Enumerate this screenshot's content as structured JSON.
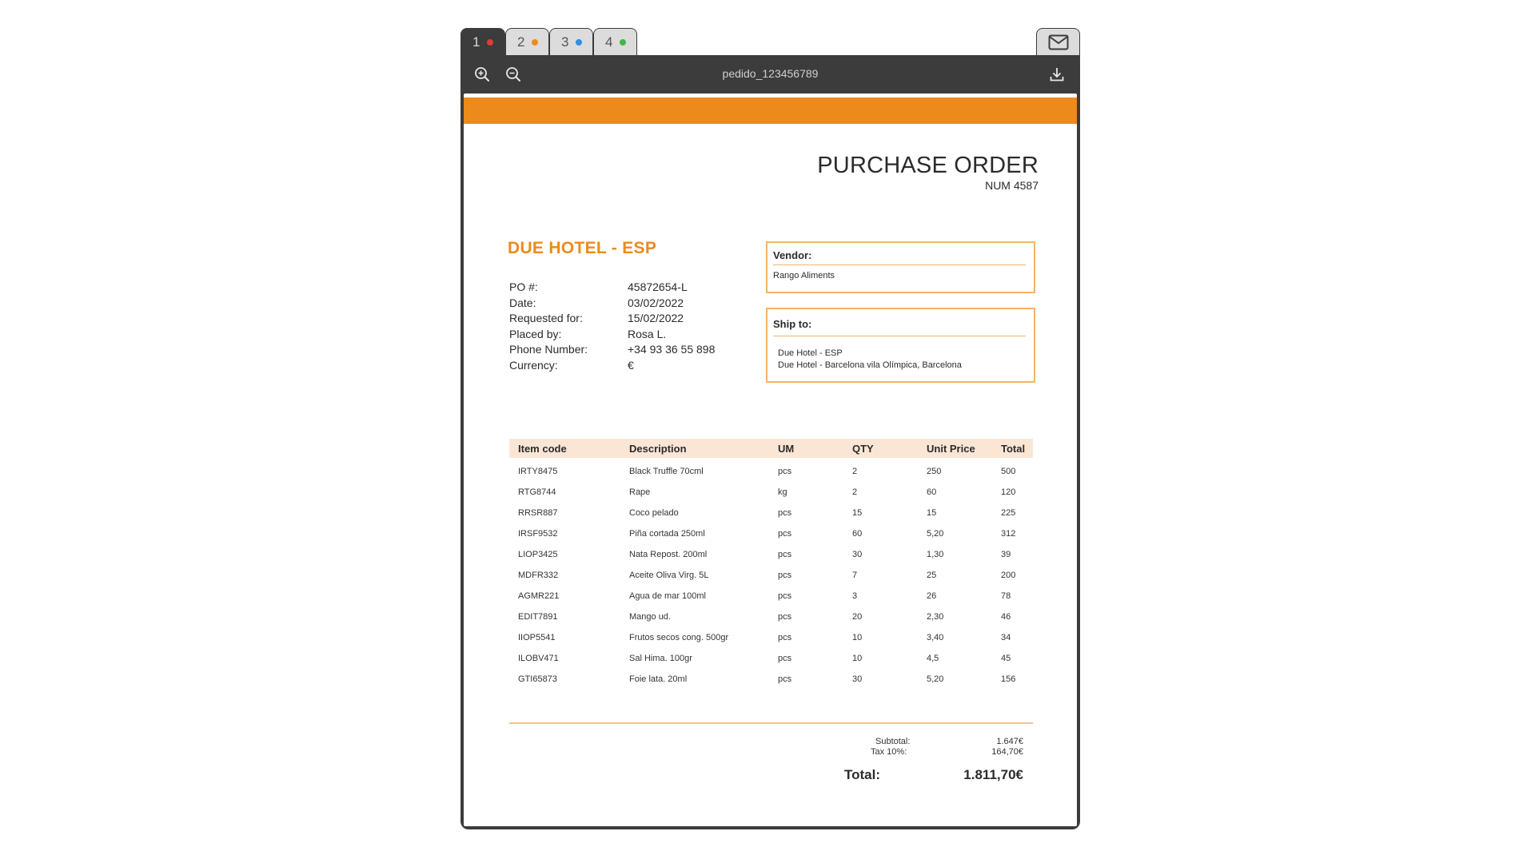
{
  "tabs": [
    {
      "label": "1",
      "dot_color": "#e53935"
    },
    {
      "label": "2",
      "dot_color": "#ef8b1c"
    },
    {
      "label": "3",
      "dot_color": "#2f8fe0"
    },
    {
      "label": "4",
      "dot_color": "#43b649"
    }
  ],
  "icons": {
    "mail": "mail-icon",
    "zoom_in": "zoom-in-icon",
    "zoom_out": "zoom-out-icon",
    "download": "download-icon"
  },
  "viewer": {
    "doc_title": "pedido_123456789"
  },
  "colors": {
    "accent": "#ed8a1c",
    "table_header_bg": "#fbe6d6",
    "box_border": "#f3b46a",
    "toolbar_bg": "#3c3c3c"
  },
  "document": {
    "title": "PURCHASE ORDER",
    "number": "NUM 4587",
    "company": "DUE HOTEL - ESP",
    "meta": [
      {
        "label": "PO #:",
        "value": "45872654-L"
      },
      {
        "label": "Date:",
        "value": "03/02/2022"
      },
      {
        "label": "Requested for:",
        "value": "15/02/2022"
      },
      {
        "label": "Placed by:",
        "value": "Rosa L."
      },
      {
        "label": "Phone Number:",
        "value": "+34 93 36 55 898"
      },
      {
        "label": "Currency:",
        "value": "€"
      }
    ],
    "vendor": {
      "title": "Vendor:",
      "lines": [
        "Rango Aliments"
      ]
    },
    "ship_to": {
      "title": "Ship to:",
      "lines": [
        "Due Hotel - ESP",
        "Due Hotel - Barcelona vila Olímpica, Barcelona"
      ]
    },
    "table": {
      "headers": [
        "Item code",
        "Description",
        "UM",
        "QTY",
        "Unit Price",
        "Total"
      ],
      "rows": [
        [
          "IRTY8475",
          "Black Truffle 70cml",
          "pcs",
          "2",
          "250",
          "500"
        ],
        [
          "RTG8744",
          "Rape",
          "kg",
          "2",
          "60",
          "120"
        ],
        [
          "RRSR887",
          "Coco pelado",
          "pcs",
          "15",
          "15",
          "225"
        ],
        [
          "IRSF9532",
          "Piña cortada 250ml",
          "pcs",
          "60",
          "5,20",
          "312"
        ],
        [
          "LIOP3425",
          "Nata Repost. 200ml",
          "pcs",
          "30",
          "1,30",
          "39"
        ],
        [
          "MDFR332",
          "Aceite Oliva Virg. 5L",
          "pcs",
          "7",
          "25",
          "200"
        ],
        [
          "AGMR221",
          "Agua de mar 100ml",
          "pcs",
          "3",
          "26",
          "78"
        ],
        [
          "EDIT7891",
          "Mango ud.",
          "pcs",
          "20",
          "2,30",
          "46"
        ],
        [
          "IIOP5541",
          "Frutos secos cong. 500gr",
          "pcs",
          "10",
          "3,40",
          "34"
        ],
        [
          "ILOBV471",
          "Sal Hima. 100gr",
          "pcs",
          "10",
          "4,5",
          "45"
        ],
        [
          "GTI65873",
          "Foie lata. 20ml",
          "pcs",
          "30",
          "5,20",
          "156"
        ]
      ]
    },
    "summary": {
      "subtotal_label": "Subtotal:",
      "subtotal_value": "1.647€",
      "tax_label": "Tax 10%:",
      "tax_value": "164,70€",
      "total_label": "Total:",
      "total_value": "1.811,70€"
    }
  }
}
